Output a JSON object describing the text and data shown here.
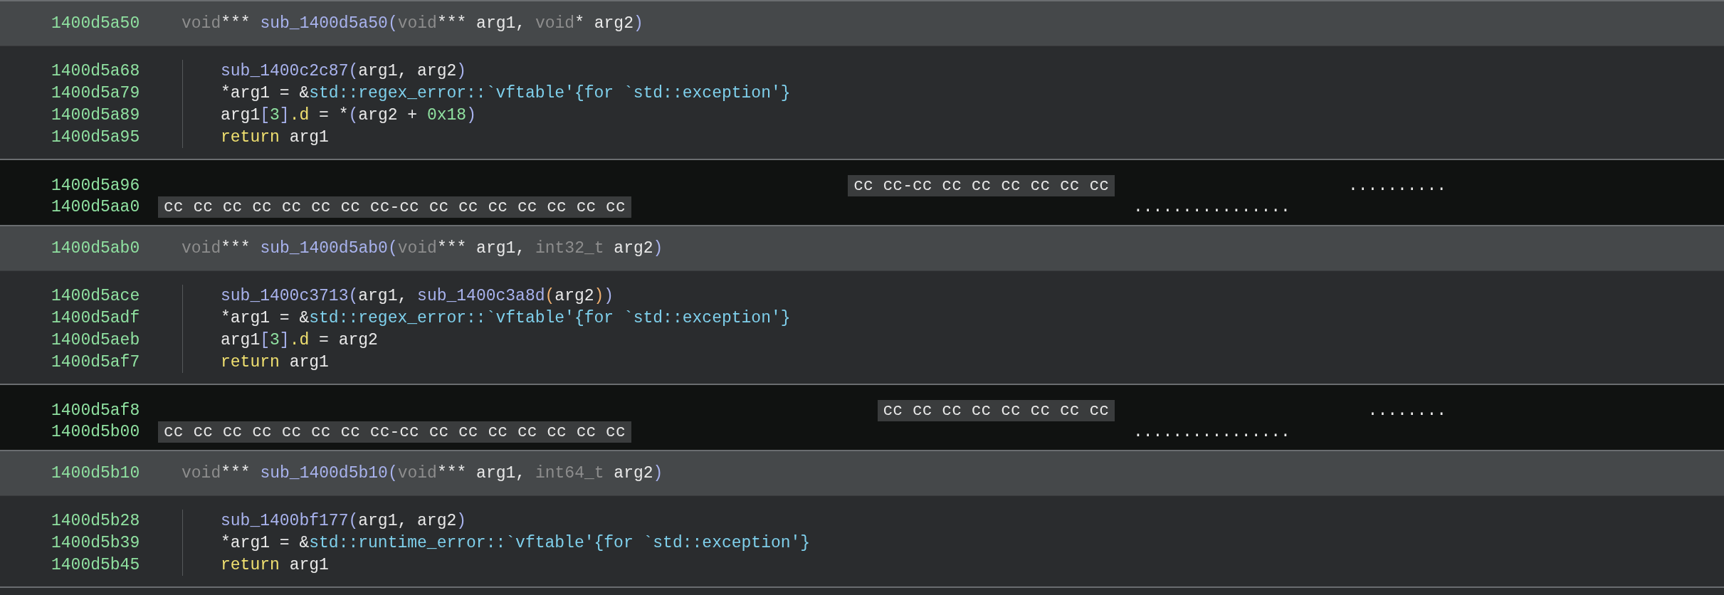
{
  "blocks": [
    {
      "kind": "function",
      "address": "1400d5a50",
      "signature": [
        {
          "kind": "type",
          "text": "void"
        },
        {
          "kind": "plain",
          "text": "*** "
        },
        {
          "kind": "func",
          "text": "sub_1400d5a50"
        },
        {
          "kind": "paren",
          "text": "("
        },
        {
          "kind": "type",
          "text": "void"
        },
        {
          "kind": "plain",
          "text": "*** arg1, "
        },
        {
          "kind": "type",
          "text": "void"
        },
        {
          "kind": "plain",
          "text": "* arg2"
        },
        {
          "kind": "paren",
          "text": ")"
        }
      ],
      "lines": [
        {
          "address": "1400d5a68",
          "tokens": [
            {
              "kind": "func",
              "text": "sub_1400c2c87"
            },
            {
              "kind": "paren",
              "text": "("
            },
            {
              "kind": "plain",
              "text": "arg1, arg2"
            },
            {
              "kind": "paren",
              "text": ")"
            }
          ]
        },
        {
          "address": "1400d5a79",
          "tokens": [
            {
              "kind": "plain",
              "text": "*arg1 = &"
            },
            {
              "kind": "symbol",
              "text": "std::regex_error::`vftable'{for `std::exception'}"
            }
          ]
        },
        {
          "address": "1400d5a89",
          "tokens": [
            {
              "kind": "plain",
              "text": "arg1"
            },
            {
              "kind": "paren",
              "text": "["
            },
            {
              "kind": "number",
              "text": "3"
            },
            {
              "kind": "paren",
              "text": "]"
            },
            {
              "kind": "field",
              "text": ".d"
            },
            {
              "kind": "plain",
              "text": " = *"
            },
            {
              "kind": "paren",
              "text": "("
            },
            {
              "kind": "plain",
              "text": "arg2 + "
            },
            {
              "kind": "number",
              "text": "0x18"
            },
            {
              "kind": "paren",
              "text": ")"
            }
          ]
        },
        {
          "address": "1400d5a95",
          "tokens": [
            {
              "kind": "keyword",
              "text": "return"
            },
            {
              "kind": "plain",
              "text": " arg1"
            }
          ]
        }
      ]
    },
    {
      "kind": "data",
      "rows": [
        {
          "kind": "tail",
          "address": "1400d5a96",
          "hex": "cc cc-cc cc cc cc cc cc cc",
          "ascii": ".........."
        },
        {
          "kind": "full",
          "address": "1400d5aa0",
          "hex": "cc cc cc cc cc cc cc cc-cc cc cc cc cc cc cc cc",
          "ascii": "................"
        }
      ]
    },
    {
      "kind": "function",
      "address": "1400d5ab0",
      "signature": [
        {
          "kind": "type",
          "text": "void"
        },
        {
          "kind": "plain",
          "text": "*** "
        },
        {
          "kind": "func",
          "text": "sub_1400d5ab0"
        },
        {
          "kind": "paren",
          "text": "("
        },
        {
          "kind": "type",
          "text": "void"
        },
        {
          "kind": "plain",
          "text": "*** arg1, "
        },
        {
          "kind": "type",
          "text": "int32_t"
        },
        {
          "kind": "plain",
          "text": " arg2"
        },
        {
          "kind": "paren",
          "text": ")"
        }
      ],
      "lines": [
        {
          "address": "1400d5ace",
          "tokens": [
            {
              "kind": "func",
              "text": "sub_1400c3713"
            },
            {
              "kind": "paren",
              "text": "("
            },
            {
              "kind": "plain",
              "text": "arg1, "
            },
            {
              "kind": "func",
              "text": "sub_1400c3a8d"
            },
            {
              "kind": "paren2",
              "text": "("
            },
            {
              "kind": "plain",
              "text": "arg2"
            },
            {
              "kind": "paren2",
              "text": ")"
            },
            {
              "kind": "paren",
              "text": ")"
            }
          ]
        },
        {
          "address": "1400d5adf",
          "tokens": [
            {
              "kind": "plain",
              "text": "*arg1 = &"
            },
            {
              "kind": "symbol",
              "text": "std::regex_error::`vftable'{for `std::exception'}"
            }
          ]
        },
        {
          "address": "1400d5aeb",
          "tokens": [
            {
              "kind": "plain",
              "text": "arg1"
            },
            {
              "kind": "paren",
              "text": "["
            },
            {
              "kind": "number",
              "text": "3"
            },
            {
              "kind": "paren",
              "text": "]"
            },
            {
              "kind": "field",
              "text": ".d"
            },
            {
              "kind": "plain",
              "text": " = arg2"
            }
          ]
        },
        {
          "address": "1400d5af7",
          "tokens": [
            {
              "kind": "keyword",
              "text": "return"
            },
            {
              "kind": "plain",
              "text": " arg1"
            }
          ]
        }
      ]
    },
    {
      "kind": "data",
      "rows": [
        {
          "kind": "tail",
          "address": "1400d5af8",
          "hex": "cc cc cc cc cc cc cc cc",
          "ascii": "........"
        },
        {
          "kind": "full",
          "address": "1400d5b00",
          "hex": "cc cc cc cc cc cc cc cc-cc cc cc cc cc cc cc cc",
          "ascii": "................"
        }
      ]
    },
    {
      "kind": "function",
      "address": "1400d5b10",
      "signature": [
        {
          "kind": "type",
          "text": "void"
        },
        {
          "kind": "plain",
          "text": "*** "
        },
        {
          "kind": "func",
          "text": "sub_1400d5b10"
        },
        {
          "kind": "paren",
          "text": "("
        },
        {
          "kind": "type",
          "text": "void"
        },
        {
          "kind": "plain",
          "text": "*** arg1, "
        },
        {
          "kind": "type",
          "text": "int64_t"
        },
        {
          "kind": "plain",
          "text": " arg2"
        },
        {
          "kind": "paren",
          "text": ")"
        }
      ],
      "lines": [
        {
          "address": "1400d5b28",
          "tokens": [
            {
              "kind": "func",
              "text": "sub_1400bf177"
            },
            {
              "kind": "paren",
              "text": "("
            },
            {
              "kind": "plain",
              "text": "arg1, arg2"
            },
            {
              "kind": "paren",
              "text": ")"
            }
          ]
        },
        {
          "address": "1400d5b39",
          "tokens": [
            {
              "kind": "plain",
              "text": "*arg1 = &"
            },
            {
              "kind": "symbol",
              "text": "std::runtime_error::`vftable'{for `std::exception'}"
            }
          ]
        },
        {
          "address": "1400d5b45",
          "tokens": [
            {
              "kind": "keyword",
              "text": "return"
            },
            {
              "kind": "plain",
              "text": " arg1"
            }
          ]
        }
      ]
    }
  ]
}
